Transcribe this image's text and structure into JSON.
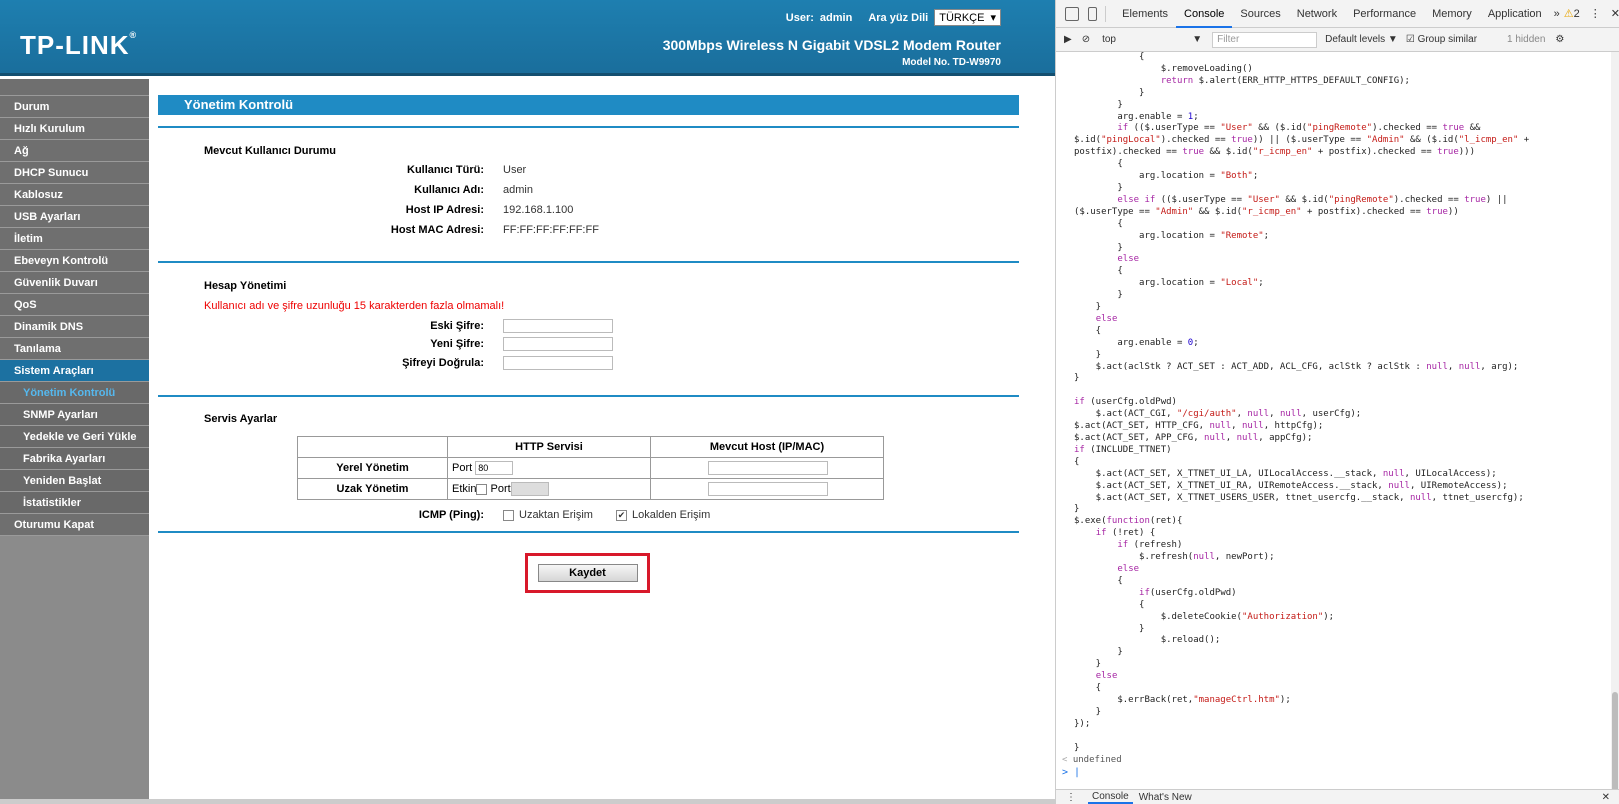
{
  "header": {
    "logo": "TP-LINK",
    "user_label": "User:",
    "user_value": "admin",
    "lang_label": "Ara yüz Dili",
    "lang_value": "TÜRKÇE",
    "product": "300Mbps Wireless N Gigabit VDSL2 Modem Router",
    "model": "Model No. TD-W9970"
  },
  "sidebar": {
    "items": [
      {
        "label": "Durum"
      },
      {
        "label": "Hızlı Kurulum"
      },
      {
        "label": "Ağ"
      },
      {
        "label": "DHCP Sunucu"
      },
      {
        "label": "Kablosuz"
      },
      {
        "label": "USB Ayarları"
      },
      {
        "label": "İletim"
      },
      {
        "label": "Ebeveyn Kontrolü"
      },
      {
        "label": "Güvenlik Duvarı"
      },
      {
        "label": "QoS"
      },
      {
        "label": "Dinamik DNS"
      },
      {
        "label": "Tanılama"
      },
      {
        "label": "Sistem Araçları"
      }
    ],
    "subitems": [
      {
        "label": "Yönetim Kontrolü"
      },
      {
        "label": "SNMP Ayarları"
      },
      {
        "label": "Yedekle ve Geri Yükle"
      },
      {
        "label": "Fabrika Ayarları"
      },
      {
        "label": "Yeniden Başlat"
      },
      {
        "label": "İstatistikler"
      }
    ],
    "logout": "Oturumu Kapat"
  },
  "main": {
    "title": "Yönetim Kontrolü",
    "status": {
      "title": "Mevcut Kullanıcı Durumu",
      "rows": [
        {
          "label": "Kullanıcı Türü:",
          "value": "User"
        },
        {
          "label": "Kullanıcı Adı:",
          "value": "admin"
        },
        {
          "label": "Host IP Adresi:",
          "value": "192.168.1.100"
        },
        {
          "label": "Host MAC Adresi:",
          "value": "FF:FF:FF:FF:FF:FF"
        }
      ]
    },
    "account": {
      "title": "Hesap Yönetimi",
      "warning": "Kullanıcı adı ve şifre uzunluğu 15 karakterden fazla olmamalı!",
      "old_pw": "Eski Şifre:",
      "new_pw": "Yeni Şifre:",
      "confirm_pw": "Şifreyi Doğrula:"
    },
    "service": {
      "title": "Servis Ayarlar",
      "col_http": "HTTP Servisi",
      "col_host": "Mevcut Host (IP/MAC)",
      "local_label": "Yerel Yönetim",
      "remote_label": "Uzak Yönetim",
      "port_label": "Port",
      "local_port": "80",
      "enable_label": "Etkin"
    },
    "icmp": {
      "label": "ICMP (Ping):",
      "remote": "Uzaktan Erişim",
      "local": "Lokalden Erişim",
      "remote_checked": false,
      "local_checked": true
    },
    "save": "Kaydet"
  },
  "devtools": {
    "tabs": [
      "Elements",
      "Console",
      "Sources",
      "Network",
      "Performance",
      "Memory",
      "Application"
    ],
    "more": "»",
    "warnings": "2",
    "context": "top",
    "filter_placeholder": "Filter",
    "levels": "Default levels",
    "group": "Group similar",
    "hidden": "1 hidden",
    "result": "undefined",
    "drawer_tabs": [
      "Console",
      "What's New"
    ]
  }
}
